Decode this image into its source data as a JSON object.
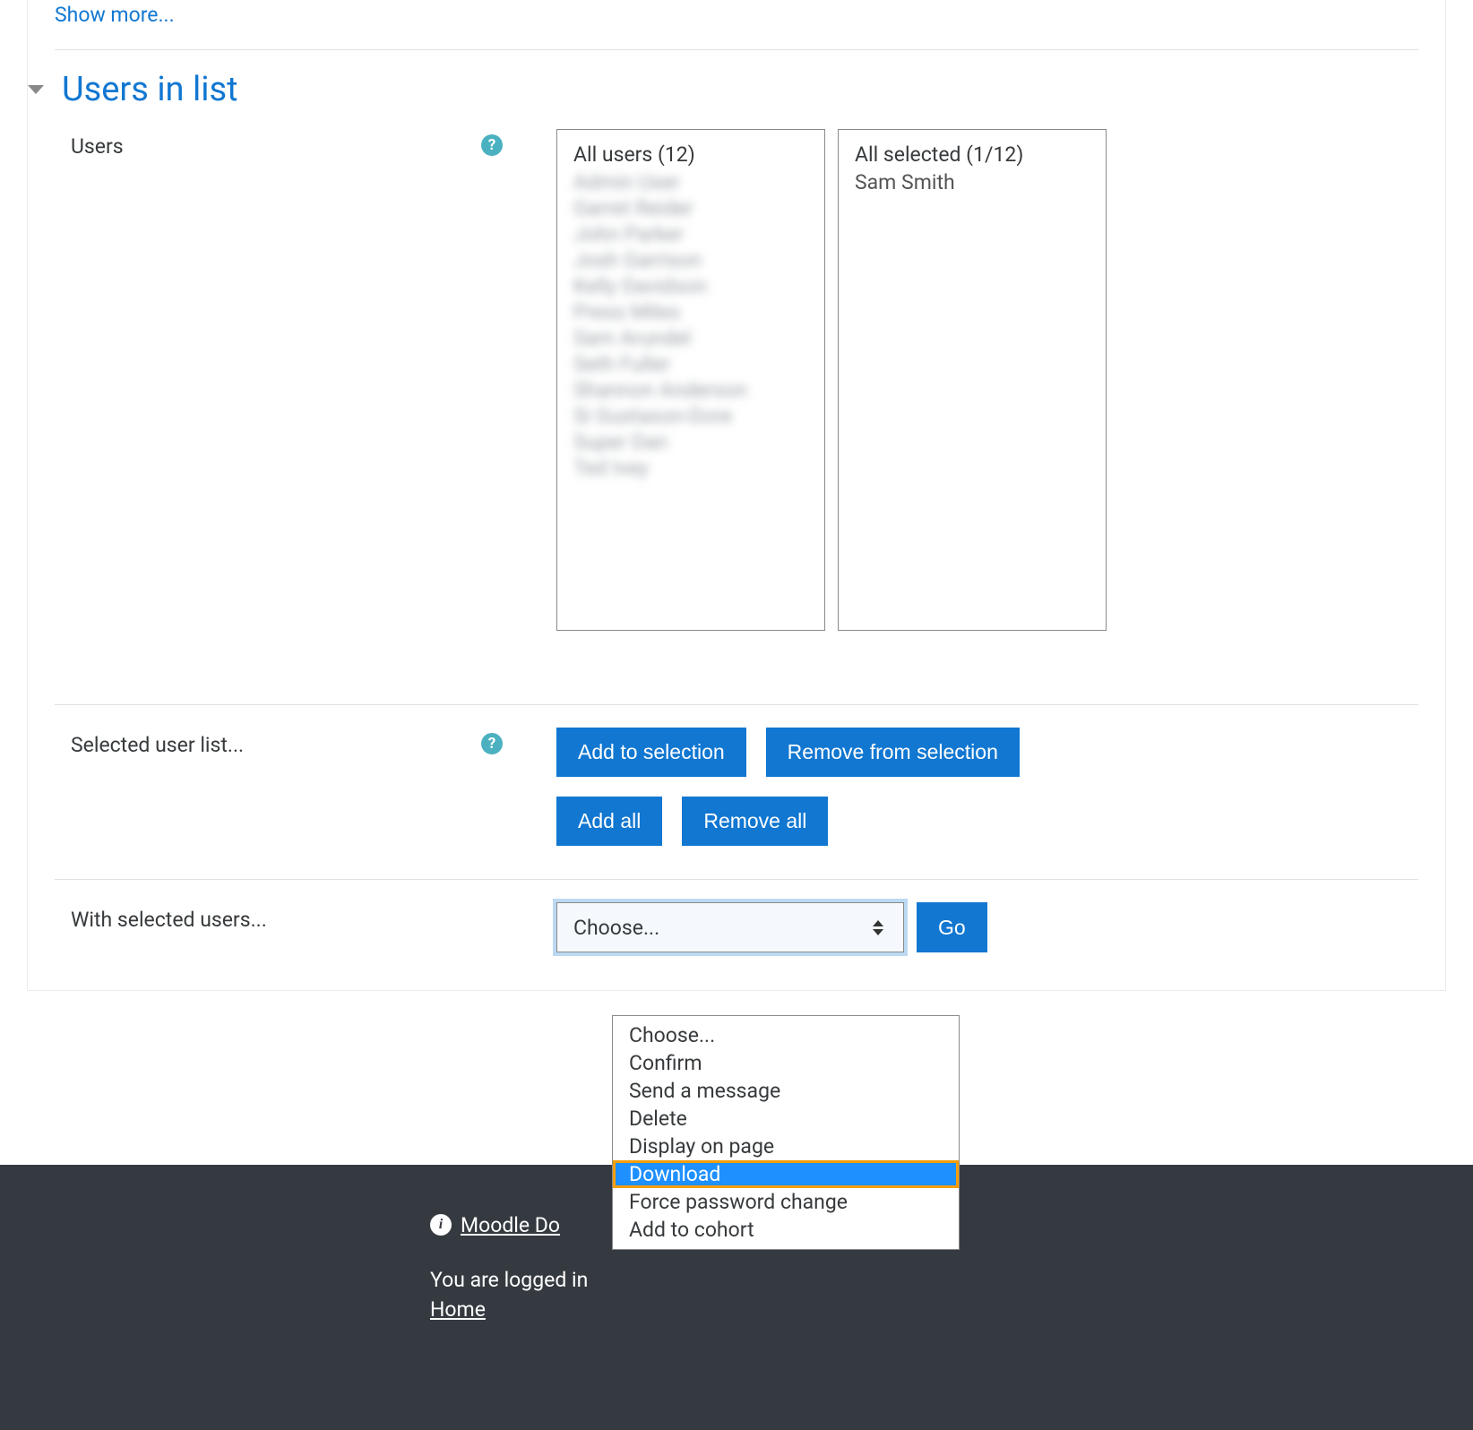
{
  "top": {
    "show_more": "Show more..."
  },
  "section": {
    "title": "Users in list"
  },
  "users": {
    "label": "Users",
    "all_header": "All users (12)",
    "all_items": [
      "Admin User",
      "Garret Reider",
      "John Parker",
      "Josh Garrison",
      "Kelly Davidson",
      "Press Miles",
      "Sam Arundel",
      "Seth Fuller",
      "Shannon Anderson",
      "Si Gustason-Dore",
      "Super Dan",
      "Ted Ivey"
    ],
    "selected_header": "All selected (1/12)",
    "selected_items": [
      "Sam Smith"
    ]
  },
  "selected_user_list": {
    "label": "Selected user list...",
    "add_to_selection": "Add to selection",
    "remove_from_selection": "Remove from selection",
    "add_all": "Add all",
    "remove_all": "Remove all"
  },
  "with_selected": {
    "label": "With selected users...",
    "selected_value": "Choose...",
    "go": "Go",
    "options": [
      "Choose...",
      "Confirm",
      "Send a message",
      "Delete",
      "Display on page",
      "Download",
      "Force password change",
      "Add to cohort"
    ],
    "highlighted": "Download"
  },
  "footer": {
    "docs_link": "Moodle Docs for this page",
    "docs_link_visible": "Moodle Do",
    "logged_in": "You are logged in",
    "home": "Home"
  }
}
